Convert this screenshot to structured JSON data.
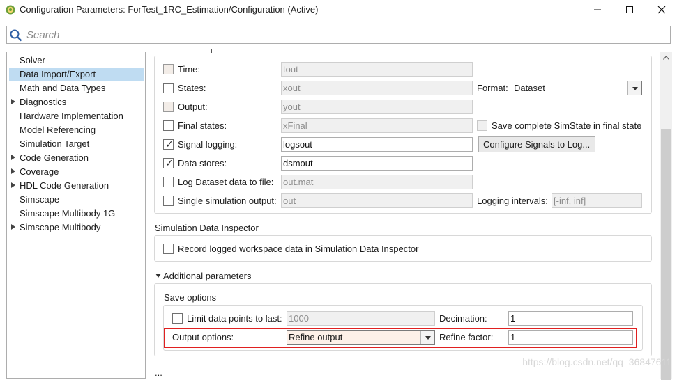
{
  "window": {
    "title": "Configuration Parameters: ForTest_1RC_Estimation/Configuration (Active)"
  },
  "search": {
    "placeholder": "Search"
  },
  "nav": {
    "items": [
      {
        "label": "Solver",
        "expandable": false,
        "selected": false
      },
      {
        "label": "Data Import/Export",
        "expandable": false,
        "selected": true
      },
      {
        "label": "Math and Data Types",
        "expandable": false,
        "selected": false
      },
      {
        "label": "Diagnostics",
        "expandable": true,
        "selected": false
      },
      {
        "label": "Hardware Implementation",
        "expandable": false,
        "selected": false
      },
      {
        "label": "Model Referencing",
        "expandable": false,
        "selected": false
      },
      {
        "label": "Simulation Target",
        "expandable": false,
        "selected": false
      },
      {
        "label": "Code Generation",
        "expandable": true,
        "selected": false
      },
      {
        "label": "Coverage",
        "expandable": true,
        "selected": false
      },
      {
        "label": "HDL Code Generation",
        "expandable": true,
        "selected": false
      },
      {
        "label": "Simscape",
        "expandable": false,
        "selected": false
      },
      {
        "label": "Simscape Multibody 1G",
        "expandable": false,
        "selected": false
      },
      {
        "label": "Simscape Multibody",
        "expandable": true,
        "selected": false
      }
    ]
  },
  "save_to_workspace": {
    "time": {
      "label": "Time:",
      "value": "tout",
      "checked": false
    },
    "states": {
      "label": "States:",
      "value": "xout",
      "checked": false
    },
    "format": {
      "label": "Format:",
      "value": "Dataset"
    },
    "output": {
      "label": "Output:",
      "value": "yout",
      "checked": false
    },
    "final_states": {
      "label": "Final states:",
      "value": "xFinal",
      "checked": false
    },
    "save_simstate": {
      "label": "Save complete SimState in final state",
      "checked": false
    },
    "signal_logging": {
      "label": "Signal logging:",
      "value": "logsout",
      "checked": true
    },
    "configure_signals_button": "Configure Signals to Log...",
    "data_stores": {
      "label": "Data stores:",
      "value": "dsmout",
      "checked": true
    },
    "log_dataset": {
      "label": "Log Dataset data to file:",
      "value": "out.mat",
      "checked": false
    },
    "single_sim": {
      "label": "Single simulation output:",
      "value": "out",
      "checked": false
    },
    "logging_intervals": {
      "label": "Logging intervals:",
      "value": "[-inf, inf]"
    }
  },
  "sdi": {
    "title": "Simulation Data Inspector",
    "record_label": "Record logged workspace data in Simulation Data Inspector",
    "record_checked": false
  },
  "additional": {
    "title": "Additional parameters",
    "save_options_title": "Save options",
    "limit": {
      "label": "Limit data points to last:",
      "value": "1000",
      "checked": false
    },
    "decimation": {
      "label": "Decimation:",
      "value": "1"
    },
    "output_options": {
      "label": "Output options:",
      "value": "Refine output"
    },
    "refine_factor": {
      "label": "Refine factor:",
      "value": "1"
    }
  },
  "more": "...",
  "watermark": "https://blog.csdn.net/qq_36847611",
  "colors": {
    "selection": "#bfdcf2",
    "highlight": "#e02020"
  }
}
